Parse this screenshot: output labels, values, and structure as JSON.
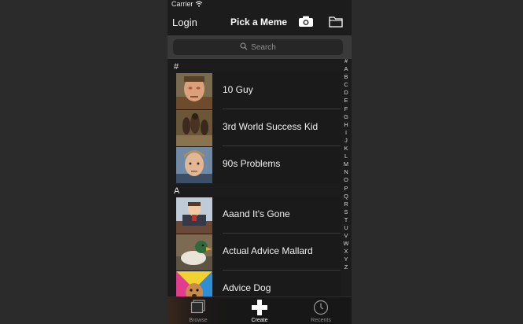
{
  "status": {
    "carrier": "Carrier"
  },
  "nav": {
    "login": "Login",
    "title": "Pick a Meme"
  },
  "search": {
    "placeholder": "Search"
  },
  "sections": [
    {
      "header": "#",
      "items": [
        "10 Guy",
        "3rd World Success Kid",
        "90s Problems"
      ]
    },
    {
      "header": "A",
      "items": [
        "Aaand It's Gone",
        "Actual Advice Mallard",
        "Advice Dog"
      ]
    }
  ],
  "index": [
    "#",
    "A",
    "B",
    "C",
    "D",
    "E",
    "F",
    "G",
    "H",
    "I",
    "J",
    "K",
    "L",
    "M",
    "N",
    "O",
    "P",
    "Q",
    "R",
    "S",
    "T",
    "U",
    "V",
    "W",
    "X",
    "Y",
    "Z"
  ],
  "tabs": {
    "browse": "Browse",
    "create": "Create",
    "recents": "Recents"
  }
}
